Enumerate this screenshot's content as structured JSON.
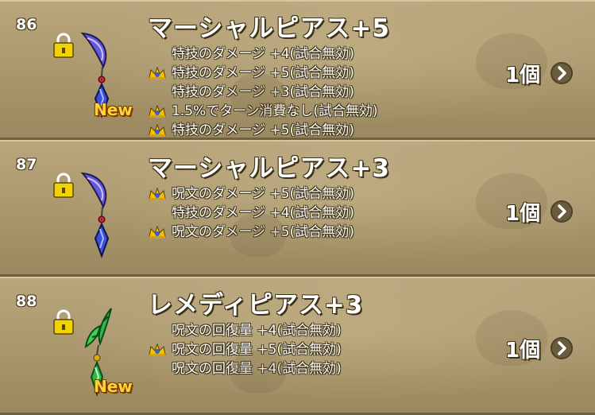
{
  "items": [
    {
      "number": "86",
      "name": "マーシャルピアス+5",
      "is_new": true,
      "new_label": "New",
      "gem_color": "#3a4fd8",
      "quantity": "1個",
      "effects": [
        {
          "text": "特技のダメージ +4(試合無効)",
          "crown": false
        },
        {
          "text": "特技のダメージ +5(試合無効)",
          "crown": true
        },
        {
          "text": "特技のダメージ +3(試合無効)",
          "crown": false
        },
        {
          "text": "1.5%でターン消費なし(試合無効)",
          "crown": true
        },
        {
          "text": "特技のダメージ +5(試合無効)",
          "crown": true
        }
      ]
    },
    {
      "number": "87",
      "name": "マーシャルピアス+3",
      "is_new": false,
      "gem_color": "#3a4fd8",
      "quantity": "1個",
      "effects": [
        {
          "text": "呪文のダメージ +5(試合無効)",
          "crown": true
        },
        {
          "text": "特技のダメージ +4(試合無効)",
          "crown": false
        },
        {
          "text": "呪文のダメージ +5(試合無効)",
          "crown": true
        }
      ]
    },
    {
      "number": "88",
      "name": "レメディピアス+3",
      "is_new": true,
      "new_label": "New",
      "gem_color": "#2fb84a",
      "quantity": "1個",
      "effects": [
        {
          "text": "呪文の回復量 +4(試合無効)",
          "crown": false
        },
        {
          "text": "呪文の回復量 +5(試合無効)",
          "crown": true
        },
        {
          "text": "呪文の回復量 +4(試合無効)",
          "crown": false
        }
      ]
    }
  ],
  "icons": {
    "lock": "padlock-icon",
    "crown": "crown-icon",
    "chevron": "chevron-right-icon"
  }
}
